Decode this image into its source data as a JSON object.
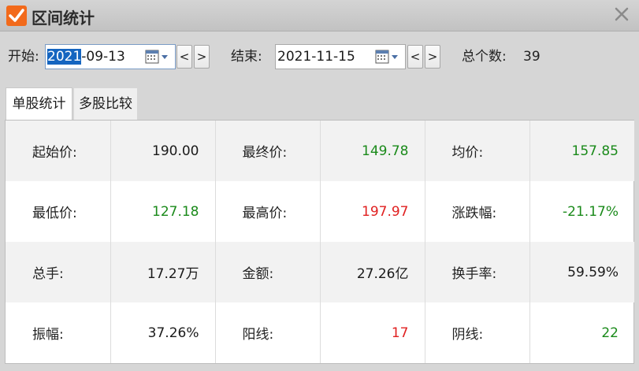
{
  "window": {
    "title": "区间统计"
  },
  "dates": {
    "start_label": "开始:",
    "start_selected": "2021",
    "start_rest": "-09-13",
    "end_label": "结束:",
    "end_value": "2021-11-15",
    "prev": "<",
    "next": ">",
    "count_label": "总个数:",
    "count_value": "39"
  },
  "tabs": [
    {
      "label": "单股统计",
      "active": true
    },
    {
      "label": "多股比较",
      "active": false
    }
  ],
  "stats": {
    "start_price": {
      "label": "起始价:",
      "value": "190.00",
      "color": "#1a1a1a"
    },
    "end_price": {
      "label": "最终价:",
      "value": "149.78",
      "color": "#1a8a1a"
    },
    "avg_price": {
      "label": "均价:",
      "value": "157.85",
      "color": "#1a8a1a"
    },
    "low_price": {
      "label": "最低价:",
      "value": "127.18",
      "color": "#1a8a1a"
    },
    "high_price": {
      "label": "最高价:",
      "value": "197.97",
      "color": "#e02020"
    },
    "change_pct": {
      "label": "涨跌幅:",
      "value": "-21.17%",
      "color": "#1a8a1a"
    },
    "volume": {
      "label": "总手:",
      "value": "17.27万",
      "color": "#1a1a1a"
    },
    "amount": {
      "label": "金额:",
      "value": "27.26亿",
      "color": "#1a1a1a"
    },
    "turnover": {
      "label": "换手率:",
      "value": "59.59%",
      "color": "#1a1a1a"
    },
    "amplitude": {
      "label": "振幅:",
      "value": "37.26%",
      "color": "#1a1a1a"
    },
    "up_days": {
      "label": "阳线:",
      "value": "17",
      "color": "#e02020"
    },
    "down_days": {
      "label": "阴线:",
      "value": "22",
      "color": "#1a8a1a"
    }
  },
  "icons": {
    "app": "checkmark-icon",
    "close": "close-icon",
    "calendar": "calendar-icon"
  },
  "colors": {
    "accent": "#f26a1b",
    "up": "#e02020",
    "down": "#1a8a1a",
    "selection": "#1565c0"
  }
}
